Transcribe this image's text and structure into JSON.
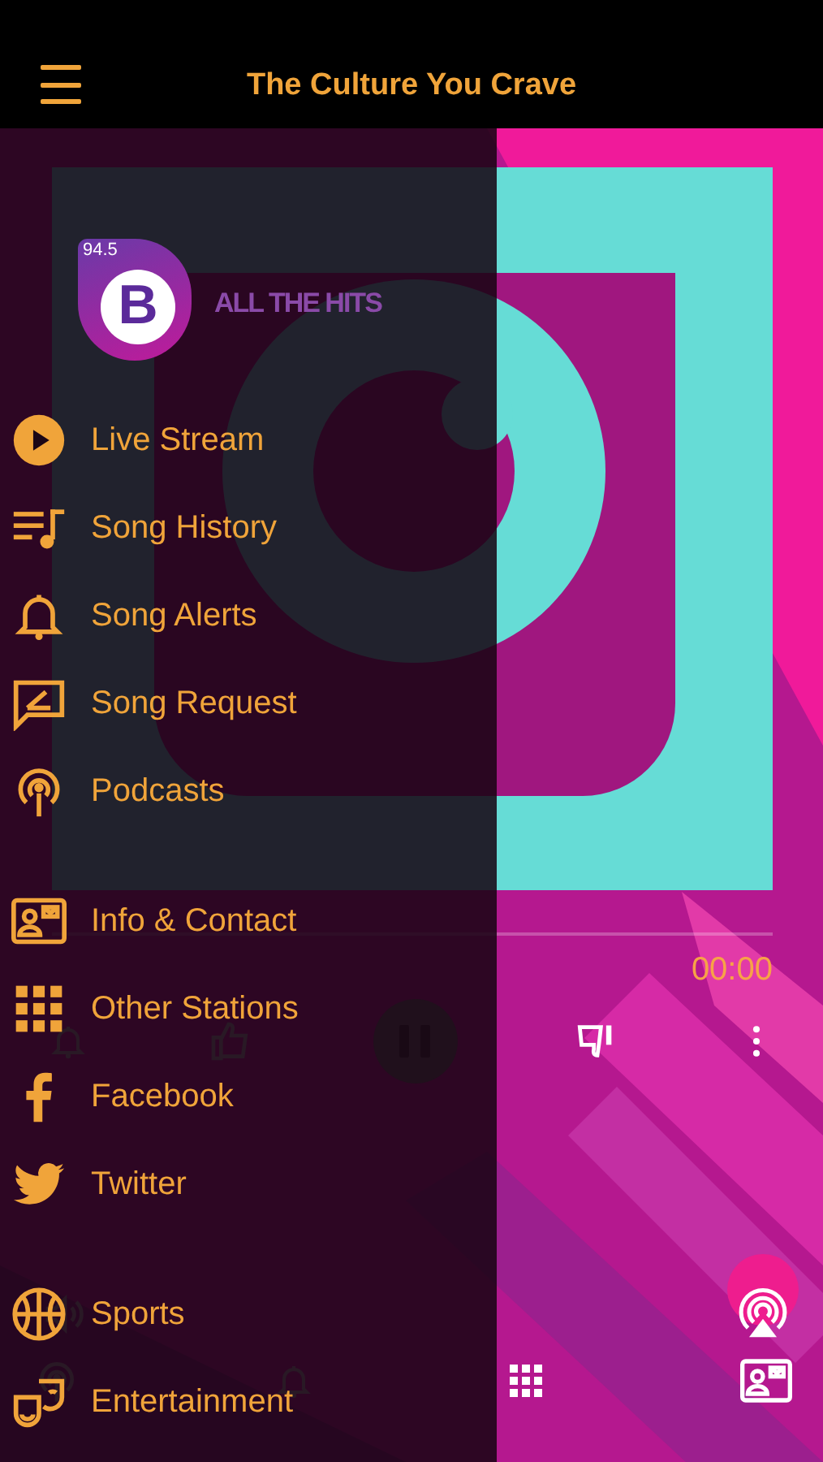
{
  "header": {
    "title": "The Culture You Crave"
  },
  "player": {
    "remaining": "00:00"
  },
  "drawer": {
    "logo": {
      "frequency": "94.5",
      "letter": "B"
    },
    "tagline": "ALL THE HITS",
    "sections": [
      [
        {
          "label": "Live Stream"
        },
        {
          "label": "Song History"
        },
        {
          "label": "Song Alerts"
        },
        {
          "label": "Song Request"
        },
        {
          "label": "Podcasts"
        }
      ],
      [
        {
          "label": "Info & Contact"
        },
        {
          "label": "Other Stations"
        },
        {
          "label": "Facebook"
        },
        {
          "label": "Twitter"
        }
      ],
      [
        {
          "label": "Sports"
        },
        {
          "label": "Entertainment"
        }
      ]
    ]
  }
}
